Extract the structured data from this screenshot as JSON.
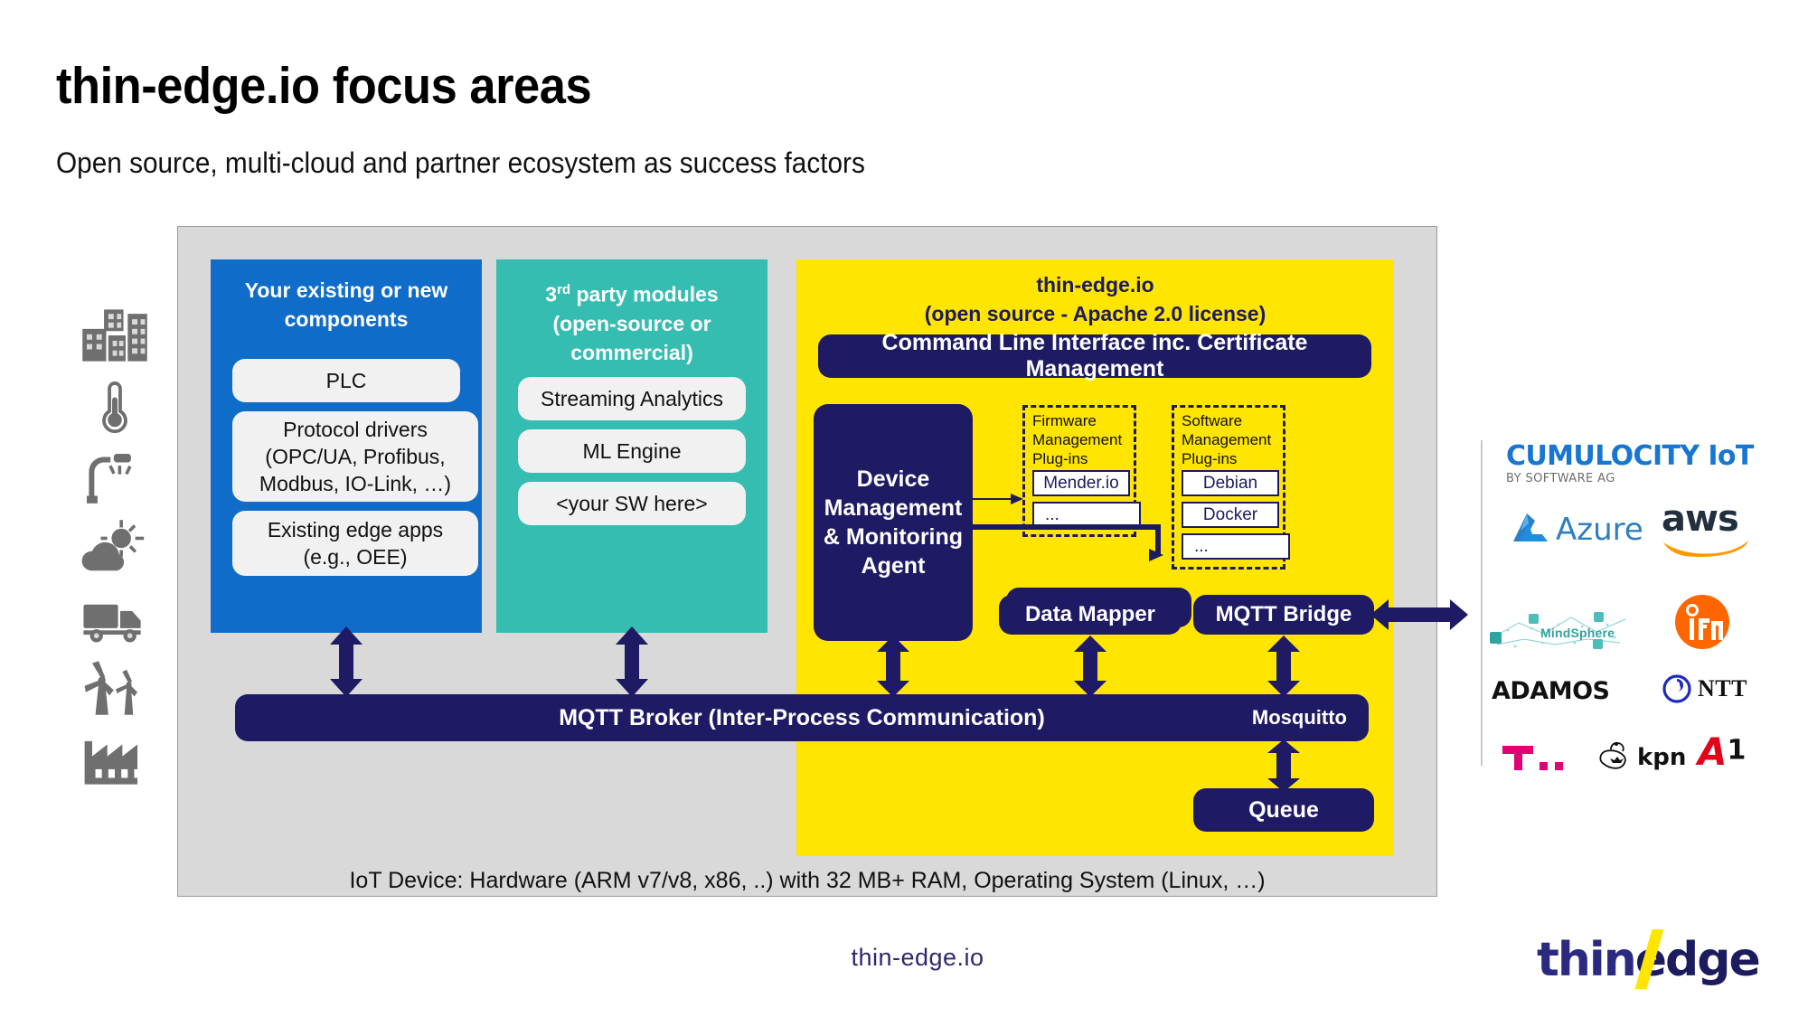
{
  "slide": {
    "title": "thin-edge.io focus areas",
    "subtitle": "Open source, multi-cloud and partner ecosystem as success factors",
    "footer_url": "thin-edge.io",
    "footer_logo": {
      "part1": "thin",
      "part2": "edge"
    }
  },
  "icon_rail": [
    {
      "name": "buildings-icon",
      "label": "Buildings"
    },
    {
      "name": "thermometer-icon",
      "label": "Temperature"
    },
    {
      "name": "streetlight-icon",
      "label": "Street lighting"
    },
    {
      "name": "weather-icon",
      "label": "Weather"
    },
    {
      "name": "truck-icon",
      "label": "Logistics"
    },
    {
      "name": "wind-turbine-icon",
      "label": "Wind energy"
    },
    {
      "name": "factory-icon",
      "label": "Factory"
    }
  ],
  "diagram": {
    "columns": {
      "your_components": {
        "title": "Your existing or new components",
        "color": "#0f6cc9",
        "items": [
          "PLC",
          "Protocol drivers (OPC/UA, Profibus, Modbus, IO-Link, …)",
          "Existing edge apps (e.g., OEE)"
        ]
      },
      "third_party": {
        "title": "3rd party modules (open-source or commercial)",
        "title_line1_prefix": "3",
        "title_line1_sup": "rd",
        "title_line1_rest": " party modules",
        "title_line2": "(open-source or",
        "title_line3": "commercial)",
        "color": "#36bdb2",
        "items": [
          "Streaming Analytics",
          "ML Engine",
          "<your SW here>"
        ]
      },
      "thin_edge": {
        "title_line1": "thin-edge.io",
        "title_line2": "(open source - Apache 2.0 license)",
        "color": "#ffe500",
        "cli_bar": "Command Line Interface inc. Certificate Management",
        "device_agent": "Device Management & Monitoring Agent",
        "device_agent_lines": [
          "Device",
          "Management",
          "& Monitoring",
          "Agent"
        ],
        "data_mapper": "Data Mapper",
        "mqtt_bridge": "MQTT Bridge",
        "queue": "Queue",
        "mqtt_broker": "MQTT Broker (Inter-Process Communication)",
        "mosquitto": "Mosquitto",
        "plugin_groups": [
          {
            "label": "Firmware Management Plug-ins",
            "label_lines": [
              "Firmware",
              "Management",
              "Plug-ins"
            ],
            "items": [
              "Mender.io",
              "..."
            ]
          },
          {
            "label": "Software Management Plug-ins",
            "label_lines": [
              "Software",
              "Management",
              "Plug-ins"
            ],
            "items": [
              "Debian",
              "Docker",
              "..."
            ]
          }
        ]
      }
    },
    "device_caption": "IoT Device: Hardware (ARM v7/v8, x86, ..) with 32 MB+ RAM, Operating System (Linux, …)"
  },
  "partners": {
    "cumulocity": {
      "name": "CUMULOCITY IoT",
      "byline": "BY SOFTWARE AG",
      "color": "#1776d2"
    },
    "azure": {
      "name": "Azure",
      "color": "#2e7fc1"
    },
    "aws": {
      "name": "aws",
      "color": "#232f3e",
      "accent": "#ff9900"
    },
    "mindsphere": {
      "name": "MindSphere",
      "color": "#2fa3a0"
    },
    "ifm": {
      "name": "ifm",
      "color": "#ff6600"
    },
    "adamos": {
      "name": "ADAMOS",
      "color": "#111111",
      "accent": "#29b6c8"
    },
    "ntt": {
      "name": "NTT",
      "color": "#1d2bbd"
    },
    "telekom": {
      "name": "T",
      "color": "#e20074"
    },
    "kpn": {
      "name": "kpn",
      "color": "#111111"
    },
    "a1": {
      "name": "A",
      "superscript": "1",
      "color": "#e2041b"
    }
  },
  "colors": {
    "navy": "#1e1a63",
    "yellow": "#ffe500",
    "blue": "#0f6cc9",
    "teal": "#36bdb2",
    "frame_gray": "#d9d9d9"
  }
}
